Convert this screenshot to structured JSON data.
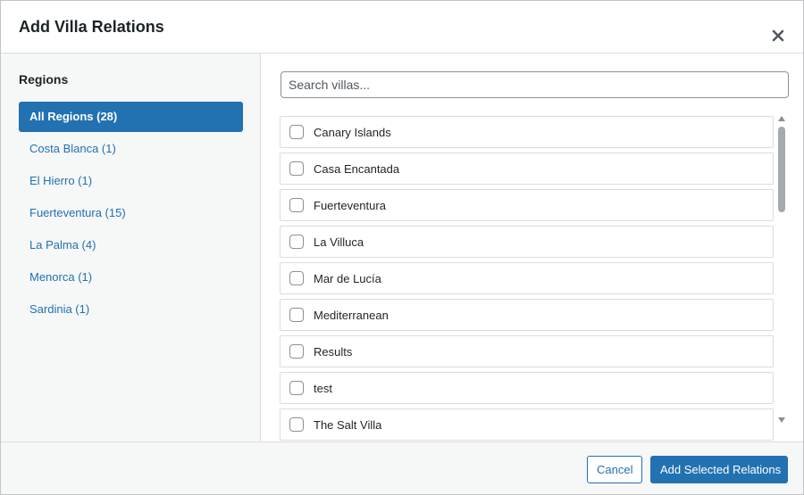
{
  "dialog": {
    "title": "Add Villa Relations",
    "close_icon": "close-icon"
  },
  "sidebar": {
    "heading": "Regions",
    "regions": [
      {
        "label": "All Regions (28)",
        "active": true
      },
      {
        "label": "Costa Blanca (1)",
        "active": false
      },
      {
        "label": "El Hierro (1)",
        "active": false
      },
      {
        "label": "Fuerteventura (15)",
        "active": false
      },
      {
        "label": "La Palma (4)",
        "active": false
      },
      {
        "label": "Menorca (1)",
        "active": false
      },
      {
        "label": "Sardinia (1)",
        "active": false
      }
    ]
  },
  "search": {
    "placeholder": "Search villas...",
    "value": ""
  },
  "villas": [
    {
      "label": "Canary Islands",
      "checked": false
    },
    {
      "label": "Casa Encantada",
      "checked": false
    },
    {
      "label": "Fuerteventura",
      "checked": false
    },
    {
      "label": "La Villuca",
      "checked": false
    },
    {
      "label": "Mar de Lucía",
      "checked": false
    },
    {
      "label": "Mediterranean",
      "checked": false
    },
    {
      "label": "Results",
      "checked": false
    },
    {
      "label": "test",
      "checked": false
    },
    {
      "label": "The Salt Villa",
      "checked": false
    }
  ],
  "footer": {
    "cancel_label": "Cancel",
    "submit_label": "Add Selected Relations"
  },
  "colors": {
    "accent": "#2271b1",
    "border": "#dcdcde",
    "sidebar_bg": "#f6f7f7"
  }
}
